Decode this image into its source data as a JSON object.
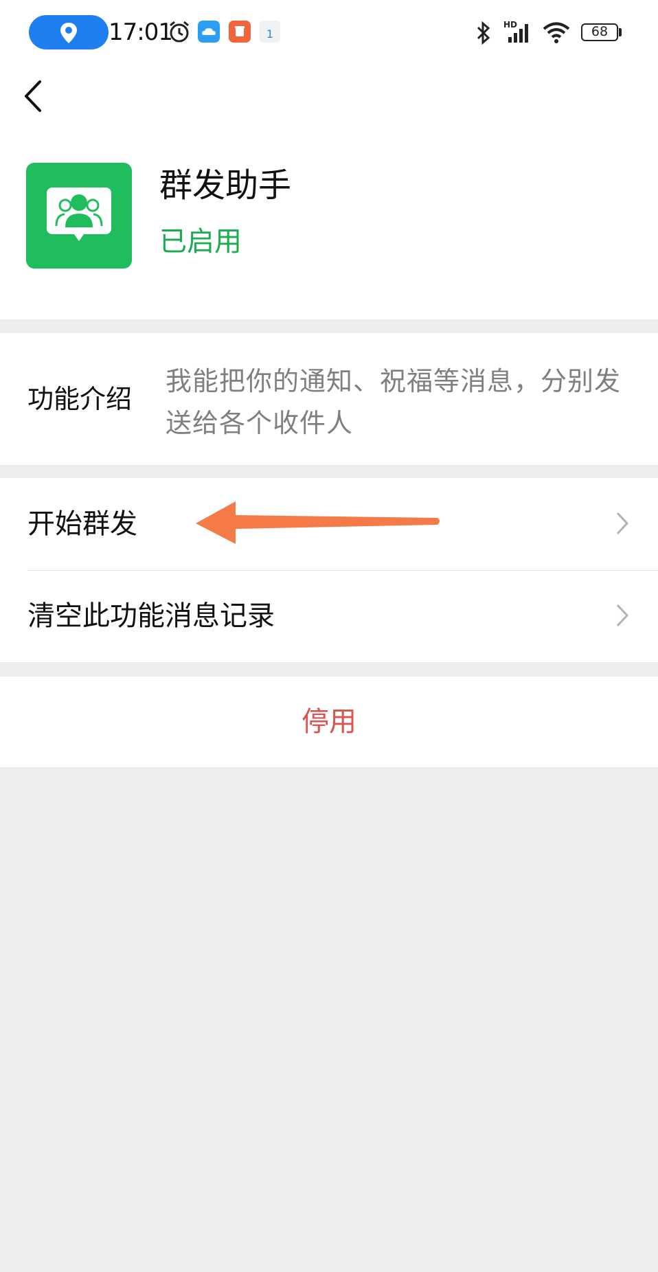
{
  "status_bar": {
    "time": "17:01",
    "battery_level": "68",
    "icons": [
      "location-icon",
      "alarm-icon",
      "cloud-app-icon",
      "orange-app-icon",
      "calendar-app-icon",
      "bluetooth-icon",
      "hd-signal-icon",
      "wifi-icon",
      "battery-icon"
    ],
    "calendar_day": "1",
    "signal_label": "HD"
  },
  "header": {
    "back_icon": "chevron-left-icon"
  },
  "app": {
    "name": "群发助手",
    "status": "已启用",
    "logo_icon": "group-message-icon",
    "accent_color": "#1fbd5c"
  },
  "intro": {
    "label": "功能介绍",
    "text": "我能把你的通知、祝福等消息，分别发送给各个收件人"
  },
  "menu": {
    "items": [
      {
        "label": "开始群发"
      },
      {
        "label": "清空此功能消息记录"
      }
    ]
  },
  "actions": {
    "disable_label": "停用",
    "disable_color": "#d9534f"
  },
  "annotation": {
    "arrow_color": "#f47a48"
  }
}
